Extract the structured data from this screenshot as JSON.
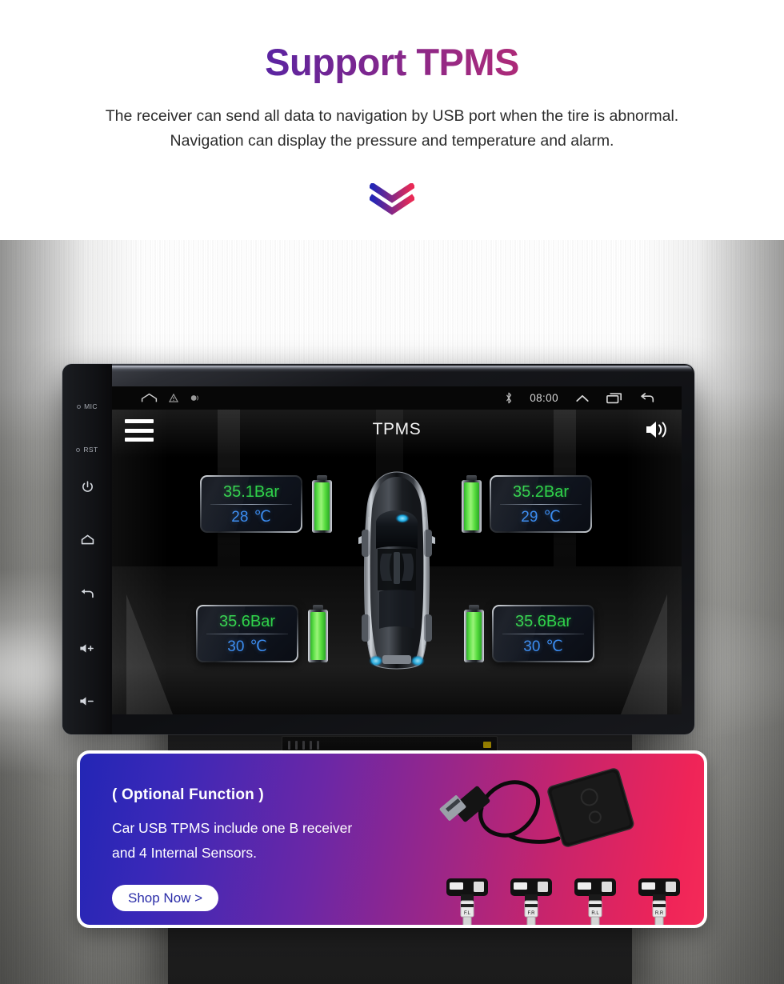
{
  "header": {
    "title_part1": "Support ",
    "title_part2": "TPMS",
    "title_full": "Support TPMS",
    "subtitle_line1": "The receiver can send all data to navigation by USB port when the tire is abnormal.",
    "subtitle_line2": "Navigation can display the pressure and temperature and alarm.",
    "chevron_icon": "double-chevron-down-icon",
    "gradient_start": "#2222cc",
    "gradient_end": "#e82a56"
  },
  "device": {
    "side_buttons": [
      {
        "name": "mic-indicator",
        "label": "MIC"
      },
      {
        "name": "rst-indicator",
        "label": "RST"
      },
      {
        "name": "power-button",
        "icon": "power-icon"
      },
      {
        "name": "home-button",
        "icon": "home-icon"
      },
      {
        "name": "back-button",
        "icon": "back-arrow-icon"
      },
      {
        "name": "volume-up-button",
        "icon": "volume-up-icon"
      },
      {
        "name": "volume-down-button",
        "icon": "volume-down-icon"
      }
    ],
    "statusbar": {
      "home_icon": "home-outline-icon",
      "warning_icon": "warning-triangle-icon",
      "record_icon": "signal-dot-icon",
      "bluetooth_icon": "bluetooth-icon",
      "time": "08:00",
      "up_icon": "chevron-up-icon",
      "recents_icon": "recent-apps-icon",
      "back_icon": "back-arrow-icon"
    },
    "app": {
      "menu_icon": "hamburger-menu-icon",
      "title": "TPMS",
      "volume_icon": "speaker-volume-icon",
      "vehicle_icon": "car-top-view-icon",
      "pressure_color": "#2fd14a",
      "temperature_color": "#3b8cf0",
      "battery_color": "#61e24a",
      "tires": [
        {
          "position": "front-left",
          "pressure": "35.1Bar",
          "temperature": "28",
          "unit": "℃",
          "battery": "full"
        },
        {
          "position": "front-right",
          "pressure": "35.2Bar",
          "temperature": "29",
          "unit": "℃",
          "battery": "full"
        },
        {
          "position": "rear-left",
          "pressure": "35.6Bar",
          "temperature": "30",
          "unit": "℃",
          "battery": "full"
        },
        {
          "position": "rear-right",
          "pressure": "35.6Bar",
          "temperature": "30",
          "unit": "℃",
          "battery": "full"
        }
      ]
    }
  },
  "promo": {
    "heading": "( Optional Function )",
    "body_line1": "Car USB TPMS include one B receiver",
    "body_line2": "and 4 Internal Sensors.",
    "cta_label": "Shop Now >",
    "cta_text_color": "#2a2ca8",
    "gradient_start": "#2326b5",
    "gradient_end": "#f42a58",
    "product_icons": [
      "usb-receiver-icon",
      "tpms-sensor-icon"
    ],
    "sensor_labels": [
      "F.L",
      "F.R",
      "R.L",
      "R.R"
    ]
  }
}
